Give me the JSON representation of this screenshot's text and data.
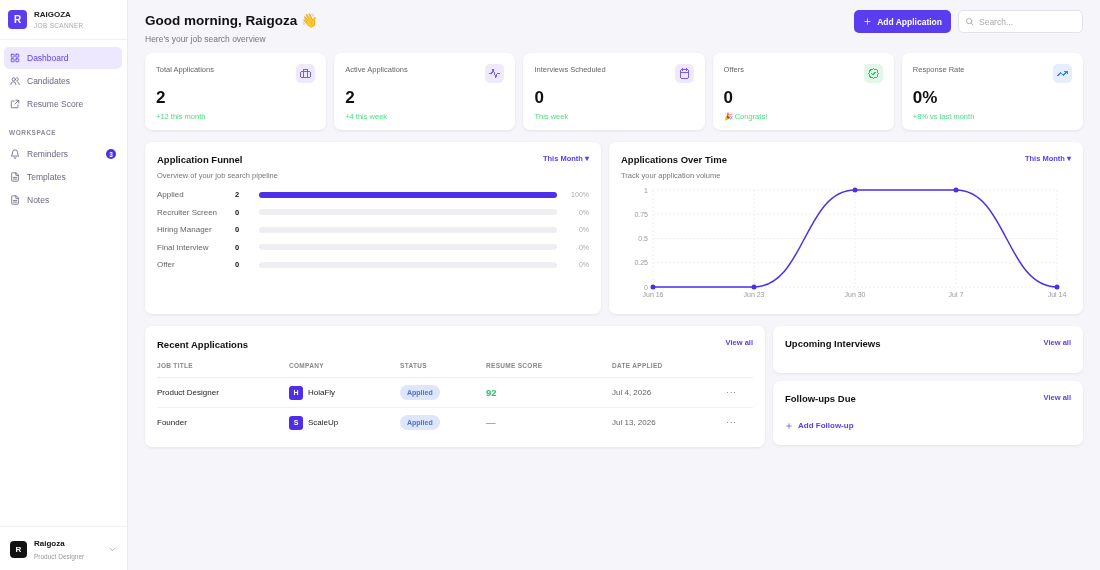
{
  "brand": {
    "logo_letter": "R",
    "name": "RAIGOZA",
    "tagline": "JOB SCANNER"
  },
  "nav": [
    {
      "label": "Dashboard",
      "selected": true
    },
    {
      "label": "Candidates",
      "selected": false
    },
    {
      "label": "Resume Score",
      "selected": false
    }
  ],
  "workspace": {
    "heading": "WORKSPACE",
    "items": [
      {
        "label": "Reminders",
        "selected": false,
        "badge": "3"
      },
      {
        "label": "Templates",
        "selected": false
      },
      {
        "label": "Notes",
        "selected": false
      }
    ]
  },
  "user": {
    "avatar_letter": "R",
    "name": "Raigoza",
    "role": "Product Designer"
  },
  "header": {
    "greeting": "Good morning, Raigoza 👋",
    "subtitle": "Here's your job search overview",
    "add_button": "Add Application",
    "search": {
      "placeholder": "Search..."
    }
  },
  "stats": [
    {
      "label": "Total Applications",
      "value": "2",
      "note": "+12 this month",
      "color": "#7c5cf0"
    },
    {
      "label": "Active Applications",
      "value": "2",
      "note": "+4 this week",
      "color": "#7c5cf0"
    },
    {
      "label": "Interviews Scheduled",
      "value": "0",
      "note": "This week",
      "color": "#7c5cf0"
    },
    {
      "label": "Offers",
      "value": "0",
      "note": "🎉 Congrats!",
      "color": "#22c55e"
    },
    {
      "label": "Response Rate",
      "value": "0%",
      "note": "+8% vs last month",
      "color": "#3b82f6"
    }
  ],
  "funnel": {
    "title": "Application Funnel",
    "subtitle": "Overview of your job search pipeline",
    "period": "This Month ▾",
    "stages": [
      {
        "name": "Applied",
        "count": "2",
        "level": 1,
        "percent": "100%"
      },
      {
        "name": "Recruiter Screen",
        "count": "0",
        "level": 0,
        "percent": "0%"
      },
      {
        "name": "Hiring Manager",
        "count": "0",
        "level": 0,
        "percent": "0%"
      },
      {
        "name": "Final Interview",
        "count": "0",
        "level": 0,
        "percent": "0%"
      },
      {
        "name": "Offer",
        "count": "0",
        "level": 0,
        "percent": "0%"
      }
    ]
  },
  "over_time": {
    "title": "Applications Over Time",
    "subtitle": "Track your application volume",
    "period": "This Month ▾",
    "chart_data": {
      "type": "line",
      "categories": [
        "Jun 16",
        "Jun 23",
        "Jun 30",
        "Jul 7",
        "Jul 14"
      ],
      "ylim": [
        0,
        1
      ],
      "grid": true,
      "yticks": [
        0,
        0.25,
        0.5,
        0.75,
        1
      ],
      "series": [
        {
          "color": "#4f2ee8",
          "values": [
            0,
            0,
            1,
            1,
            0
          ]
        }
      ]
    }
  },
  "recent": {
    "title": "Recent Applications",
    "view_all": "View all",
    "columns": [
      "JOB TITLE",
      "COMPANY",
      "STATUS",
      "RESUME SCORE",
      "DATE APPLIED"
    ],
    "rows": [
      {
        "job_title": "Product Designer",
        "logo_letter": "H",
        "company": "HolaFly",
        "status": "Applied",
        "score": "92",
        "color": "#22c55e",
        "date": "Jul 4, 2026",
        "menu": "···"
      },
      {
        "job_title": "Founder",
        "logo_letter": "S",
        "company": "ScaleUp",
        "status": "Applied",
        "score": "—",
        "color": "#9ca3af",
        "date": "Jul 13, 2026",
        "menu": "···"
      }
    ]
  },
  "upcoming": {
    "title": "Upcoming Interviews",
    "view_all": "View all"
  },
  "followups": {
    "title": "Follow-ups Due",
    "view_all": "View all",
    "add": "Add Follow-up"
  }
}
